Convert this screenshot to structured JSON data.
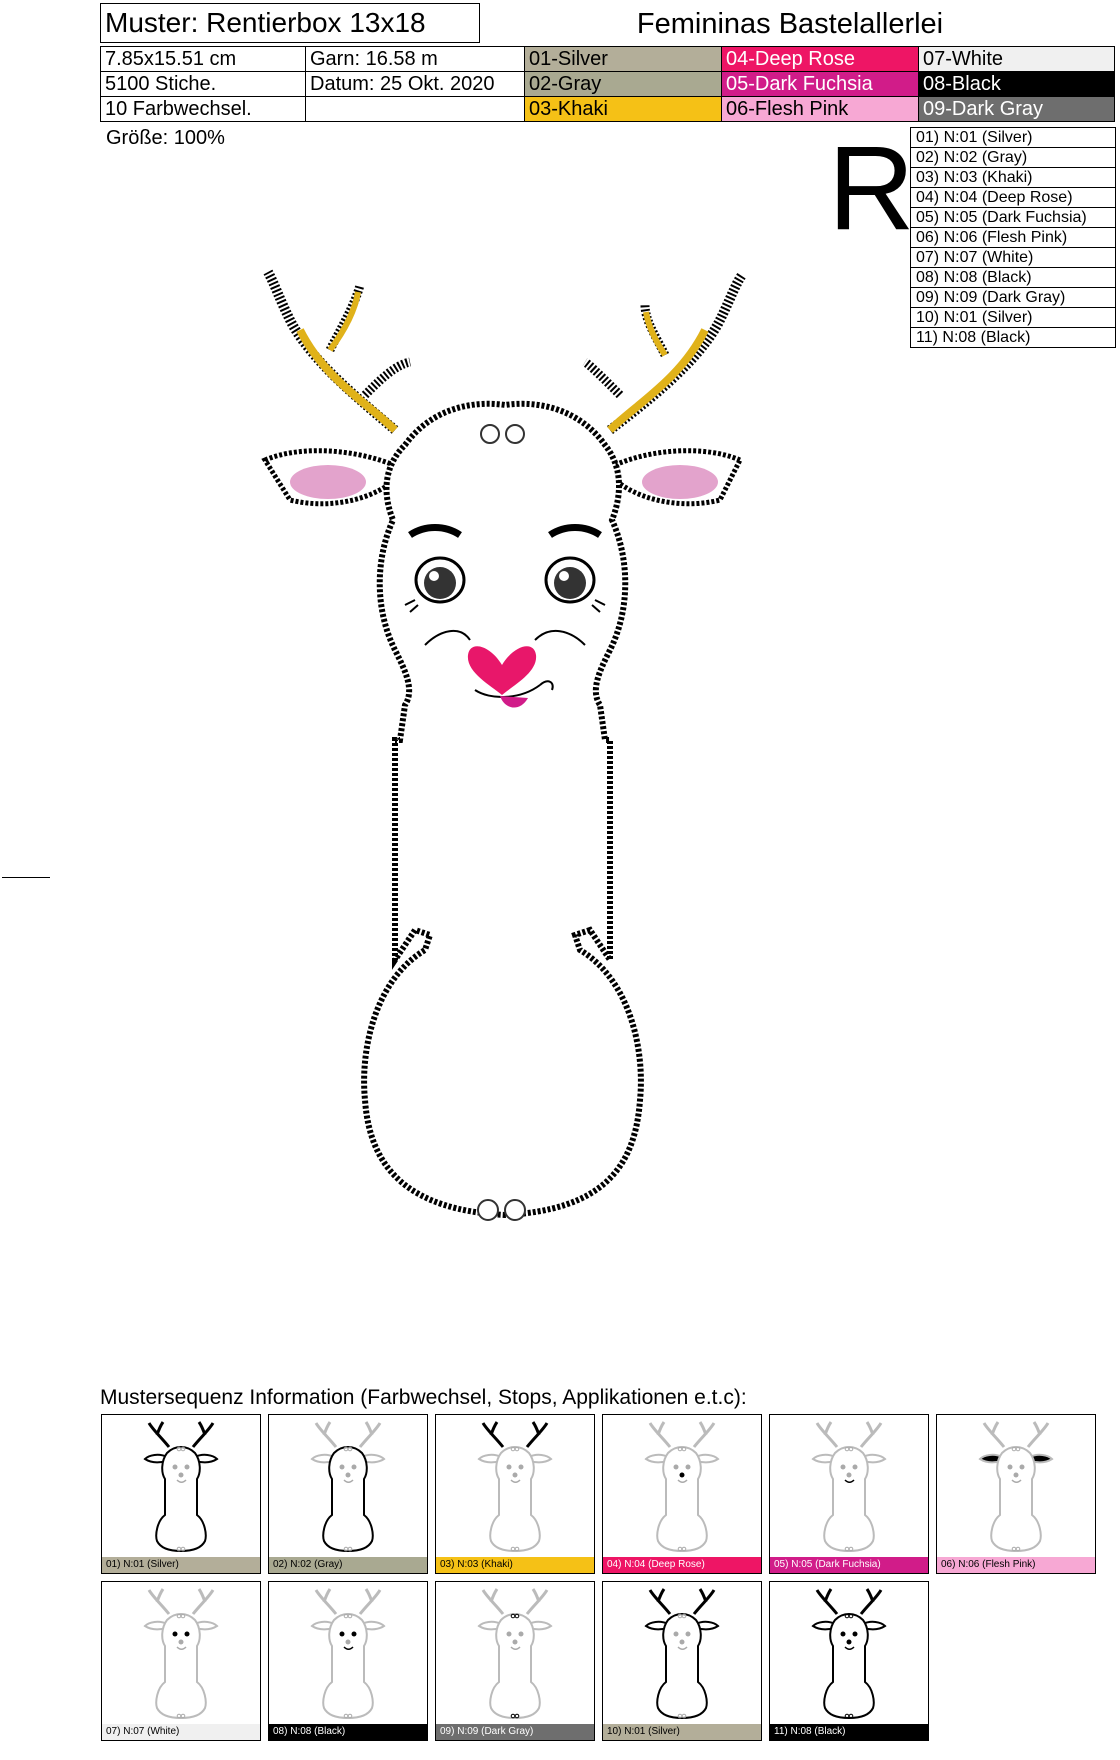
{
  "header": {
    "title": "Muster: Rentierbox 13x18",
    "company": "Femininas Bastelallerlei"
  },
  "info": {
    "size": "7.85x15.51 cm",
    "yarn": "Garn: 16.58 m",
    "stitches": "5100 Stiche.",
    "date": "Datum: 25 Okt. 2020",
    "color_changes": "10 Farbwechsel."
  },
  "colors": [
    {
      "label": "01-Silver",
      "hex": "#B3AE99",
      "text": "#000000"
    },
    {
      "label": "02-Gray",
      "hex": "#A9A991",
      "text": "#000000"
    },
    {
      "label": "03-Khaki",
      "hex": "#F5C116",
      "text": "#000000"
    },
    {
      "label": "04-Deep Rose",
      "hex": "#EE1565",
      "text": "#ffffff"
    },
    {
      "label": "05-Dark Fuchsia",
      "hex": "#D11C89",
      "text": "#ffffff"
    },
    {
      "label": "06-Flesh Pink",
      "hex": "#F7A8D4",
      "text": "#000000"
    },
    {
      "label": "07-White",
      "hex": "#F0F0F0",
      "text": "#000000"
    },
    {
      "label": "08-Black",
      "hex": "#000000",
      "text": "#ffffff"
    },
    {
      "label": "09-Dark Gray",
      "hex": "#6E6E6E",
      "text": "#ffffff"
    }
  ],
  "size_label": "Größe: 100%",
  "letter": "R",
  "sequence": [
    "01) N:01 (Silver)",
    "02) N:02 (Gray)",
    "03) N:03 (Khaki)",
    "04) N:04 (Deep Rose)",
    "05) N:05 (Dark Fuchsia)",
    "06) N:06 (Flesh Pink)",
    "07) N:07 (White)",
    "08) N:08 (Black)",
    "09) N:09 (Dark Gray)",
    "10) N:01 (Silver)",
    "11) N:08 (Black)"
  ],
  "sequence_title": "Mustersequenz Information (Farbwechsel, Stops, Applikationen e.t.c):",
  "thumbnails": [
    {
      "caption": "01) N:01 (Silver)",
      "color": "#B3AE99",
      "text": "#000000",
      "focus": "outline"
    },
    {
      "caption": "02) N:02 (Gray)",
      "color": "#A9A991",
      "text": "#000000",
      "focus": "body"
    },
    {
      "caption": "03) N:03 (Khaki)",
      "color": "#F5C116",
      "text": "#000000",
      "focus": "antlers"
    },
    {
      "caption": "04) N:04 (Deep Rose)",
      "color": "#EE1565",
      "text": "#ffffff",
      "focus": "nose"
    },
    {
      "caption": "05) N:05 (Dark Fuchsia)",
      "color": "#D11C89",
      "text": "#ffffff",
      "focus": "mouth"
    },
    {
      "caption": "06) N:06 (Flesh Pink)",
      "color": "#F7A8D4",
      "text": "#000000",
      "focus": "ears"
    },
    {
      "caption": "07) N:07 (White)",
      "color": "#F0F0F0",
      "text": "#000000",
      "focus": "eyes"
    },
    {
      "caption": "08) N:08 (Black)",
      "color": "#000000",
      "text": "#ffffff",
      "focus": "face"
    },
    {
      "caption": "09) N:09 (Dark Gray)",
      "color": "#6E6E6E",
      "text": "#ffffff",
      "focus": "dots"
    },
    {
      "caption": "10) N:01 (Silver)",
      "color": "#B3AE99",
      "text": "#000000",
      "focus": "outline"
    },
    {
      "caption": "11) N:08 (Black)",
      "color": "#000000",
      "text": "#ffffff",
      "focus": "all"
    }
  ]
}
